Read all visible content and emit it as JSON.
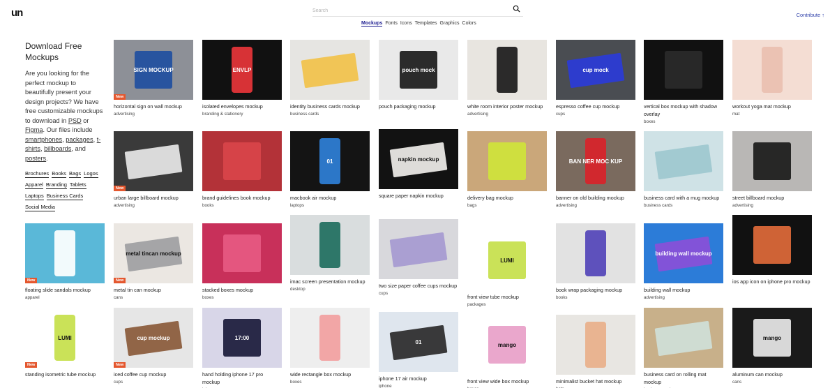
{
  "header": {
    "logo": "un",
    "search_placeholder": "Search",
    "contribute": "Contribute ↑",
    "nav": [
      "Mockups",
      "Fonts",
      "Icons",
      "Templates",
      "Graphics",
      "Colors"
    ]
  },
  "intro": {
    "title": "Download Free Mockups",
    "text_1": "Are you looking for the perfect mockup to beautifully present your design projects? We have free customizable mockups to download in ",
    "psd": "PSD",
    "or": " or ",
    "figma": "Figma",
    "text_2": ". Our files include ",
    "smartphones": "smartphones",
    "packages": "packages",
    "tshirts": "t-shirts",
    "billboards": "billboards",
    "and": ", and ",
    "posters": "posters",
    "comma": ", ",
    "period": ".",
    "tags": [
      "Brochures",
      "Books",
      "Bags",
      "Logos",
      "Apparel",
      "Branding",
      "Tablets",
      "Laptops",
      "Business Cards",
      "Social Media"
    ]
  },
  "badge_new": "New",
  "cards": [
    {
      "title": "horizontal sign on wall mockup",
      "category": "advertising",
      "new": true,
      "bg": "#8d9097",
      "fg": "#1f4fa0",
      "label": "SIGN MOCKUP"
    },
    {
      "title": "isolated envelopes mockup",
      "category": "branding & stationery",
      "new": false,
      "bg": "#111111",
      "fg": "#e8353a",
      "label": "ENVLP"
    },
    {
      "title": "identity business cards mockup",
      "category": "business cards",
      "new": false,
      "bg": "#e6e5e2",
      "fg": "#f2c24a",
      "label": ""
    },
    {
      "title": "pouch packaging mockup",
      "category": "",
      "new": false,
      "bg": "#e9e9e9",
      "fg": "#1a1a1a",
      "label": "pouch mock"
    },
    {
      "title": "white room interior poster mockup",
      "category": "advertising",
      "new": false,
      "bg": "#e8e5e0",
      "fg": "#1a1a1a",
      "label": ""
    },
    {
      "title": "espresso coffee cup mockup",
      "category": "cups",
      "new": false,
      "bg": "#4a4d52",
      "fg": "#2a3bd8",
      "label": "cup mock"
    },
    {
      "title": "vertical box mockup with shadow overlay",
      "category": "boxes",
      "new": false,
      "bg": "#111111",
      "fg": "#2a2a2a",
      "label": ""
    },
    {
      "title": "workout yoga mat mockup",
      "category": "mat",
      "new": false,
      "bg": "#f4ddd3",
      "fg": "#e9bfb0",
      "label": ""
    },
    {
      "title": "urban large billboard mockup",
      "category": "advertising",
      "new": true,
      "bg": "#3a3a3a",
      "fg": "#e8e8e8",
      "label": ""
    },
    {
      "title": "brand guidelines book mockup",
      "category": "books",
      "new": false,
      "bg": "#b33238",
      "fg": "#d9444a",
      "label": ""
    },
    {
      "title": "macbook air mockup",
      "category": "laptops",
      "new": false,
      "bg": "#141414",
      "fg": "#2f80d8",
      "label": "01"
    },
    {
      "title": "square paper napkin mockup",
      "category": "",
      "new": false,
      "bg": "#121212",
      "fg": "#f0eeea",
      "label": "napkin mockup"
    },
    {
      "title": "delivery bag mockup",
      "category": "bags",
      "new": false,
      "bg": "#caa77a",
      "fg": "#cfe43a",
      "label": ""
    },
    {
      "title": "banner on old building mockup",
      "category": "advertising",
      "new": false,
      "bg": "#7a6a5e",
      "fg": "#d8232a",
      "label": "BAN NER MOC KUP"
    },
    {
      "title": "business card with a mug mockup",
      "category": "business cards",
      "new": false,
      "bg": "#cfe2e6",
      "fg": "#9ec8cf",
      "label": ""
    },
    {
      "title": "street billboard mockup",
      "category": "advertising",
      "new": false,
      "bg": "#b9b7b5",
      "fg": "#1a1a1a",
      "label": ""
    },
    {
      "title": "floating slide sandals mockup",
      "category": "apparel",
      "new": true,
      "bg": "#5ab8d8",
      "fg": "#ffffff",
      "label": ""
    },
    {
      "title": "metal tin can mockup",
      "category": "cans",
      "new": true,
      "bg": "#ebe7e2",
      "fg": "#9ea0a2",
      "label": "metal tincan mockup"
    },
    {
      "title": "stacked boxes mockup",
      "category": "boxes",
      "new": false,
      "bg": "#c8305a",
      "fg": "#e65a82",
      "label": ""
    },
    {
      "title": "imac screen presentation mockup",
      "category": "desktop",
      "new": false,
      "bg": "#d9ddde",
      "fg": "#1f6e5e",
      "label": ""
    },
    {
      "title": "two size paper coffee cups mockup",
      "category": "cups",
      "new": false,
      "bg": "#d8d8dc",
      "fg": "#a69ad0",
      "label": ""
    },
    {
      "title": "front view tube mockup",
      "category": "packages",
      "new": false,
      "bg": "#ffffff",
      "fg": "#c6e04a",
      "label": "LUMI"
    },
    {
      "title": "book wrap packaging mockup",
      "category": "books",
      "new": false,
      "bg": "#e2e2e2",
      "fg": "#5244b8",
      "label": ""
    },
    {
      "title": "building wall mockup",
      "category": "advertising",
      "new": false,
      "bg": "#2c7cd8",
      "fg": "#8a4fd8",
      "label": "building wall mockup"
    },
    {
      "title": "ios app icon on iphone pro mockup",
      "category": "",
      "new": false,
      "bg": "#111111",
      "fg": "#e06a3a",
      "label": ""
    },
    {
      "title": "standing isometric tube mockup",
      "category": "",
      "new": true,
      "bg": "#ffffff",
      "fg": "#c6e04a",
      "label": "LUMI"
    },
    {
      "title": "iced coffee cup mockup",
      "category": "cups",
      "new": true,
      "bg": "#e6e6e6",
      "fg": "#8a5a3a",
      "label": "cup mockup"
    },
    {
      "title": "hand holding iphone 17 pro mockup",
      "category": "iphone",
      "new": false,
      "bg": "#d8d6e8",
      "fg": "#1a1a3a",
      "label": "17:00"
    },
    {
      "title": "wide rectangle box mockup",
      "category": "boxes",
      "new": false,
      "bg": "#eeeeee",
      "fg": "#f2a0a0",
      "label": ""
    },
    {
      "title": "iphone 17 air mockup",
      "category": "iphone",
      "new": false,
      "bg": "#dfe6ee",
      "fg": "#2a2a2a",
      "label": "01"
    },
    {
      "title": "front view wide box mockup",
      "category": "boxes",
      "new": false,
      "bg": "#ffffff",
      "fg": "#e8a0c8",
      "label": "mango"
    },
    {
      "title": "minimalist bucket hat mockup",
      "category": "hats",
      "new": false,
      "bg": "#e8e6e2",
      "fg": "#e8b08a",
      "label": ""
    },
    {
      "title": "business card on rolling mat mockup",
      "category": "business cards",
      "new": false,
      "bg": "#c8b08a",
      "fg": "#cfe0d8",
      "label": ""
    },
    {
      "title": "aluminum can mockup",
      "category": "cans",
      "new": false,
      "bg": "#1a1a1a",
      "fg": "#e8e8e8",
      "label": "mango"
    }
  ]
}
